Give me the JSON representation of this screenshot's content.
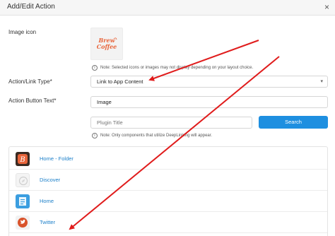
{
  "dialog": {
    "title": "Add/Edit Action",
    "close_glyph": "×"
  },
  "image_icon": {
    "label": "Image icon",
    "preview_text": "Brew Coffee",
    "note_icon": "info-icon",
    "note": "Note: Selected icons or images may not display depending on your layout choice."
  },
  "action_type": {
    "label": "Action/Link Type",
    "required_mark": "*",
    "selected": "Link to App Content",
    "chevron_icon": "chevron-down-icon"
  },
  "button_text": {
    "label": "Action Button Text",
    "required_mark": "*",
    "value": "Image"
  },
  "search": {
    "placeholder": "Plugin Title",
    "button_label": "Search",
    "note": "Note: Only components that utilize DeepLinking will appear."
  },
  "plugins": [
    {
      "label": "Home - Folder",
      "icon": "folder-app-icon"
    },
    {
      "label": "Discover",
      "icon": "discover-icon"
    },
    {
      "label": "Home",
      "icon": "home-app-icon"
    },
    {
      "label": "Twitter",
      "icon": "twitter-icon"
    }
  ],
  "colors": {
    "accent": "#1e8fe0",
    "link": "#1b7fc9",
    "annotation_arrow": "#e01c1c",
    "brand_orange": "#e8643a"
  }
}
